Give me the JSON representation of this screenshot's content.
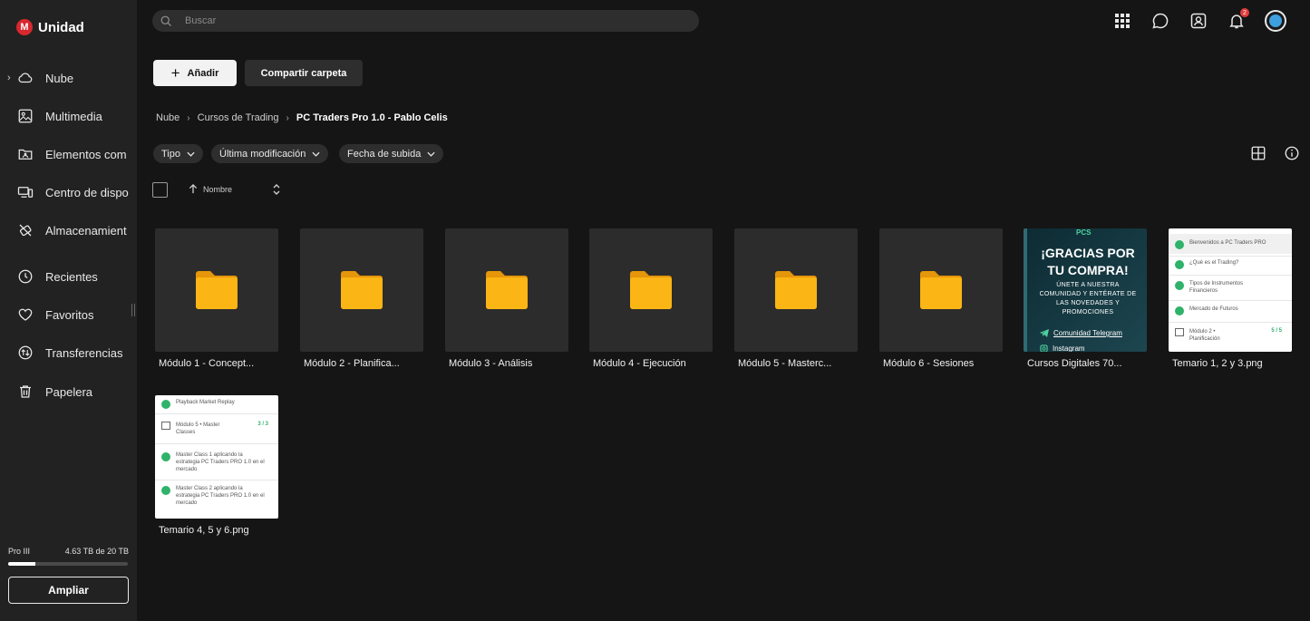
{
  "app": {
    "name": "Unidad",
    "logo_letter": "M"
  },
  "sidebar": {
    "items": [
      {
        "label": "Nube",
        "icon": "cloud-icon"
      },
      {
        "label": "Multimedia",
        "icon": "image-icon"
      },
      {
        "label": "Elementos com",
        "icon": "shared-folder-icon"
      },
      {
        "label": "Centro de dispo",
        "icon": "devices-icon"
      },
      {
        "label": "Almacenamient",
        "icon": "storage-icon"
      },
      {
        "label": "Recientes",
        "icon": "clock-icon"
      },
      {
        "label": "Favoritos",
        "icon": "heart-icon"
      },
      {
        "label": "Transferencias",
        "icon": "transfer-icon"
      },
      {
        "label": "Papelera",
        "icon": "trash-icon"
      }
    ],
    "plan": {
      "name": "Pro III",
      "usage": "4.63 TB de 20 TB",
      "used_fraction": 0.23
    },
    "upgrade_label": "Ampliar"
  },
  "topbar": {
    "search_placeholder": "Buscar",
    "notification_count": "2"
  },
  "toolbar": {
    "add_label": "Añadir",
    "share_label": "Compartir carpeta"
  },
  "breadcrumb": {
    "root": "Nube",
    "parent": "Cursos de Trading",
    "current": "PC Traders Pro 1.0 - Pablo Celis"
  },
  "filters": {
    "type": "Tipo",
    "modified": "Última modificación",
    "uploaded": "Fecha de subida"
  },
  "list_header": {
    "sort_label": "Nombre"
  },
  "items": [
    {
      "name": "Módulo 1 - Concept...",
      "kind": "folder"
    },
    {
      "name": "Módulo 2 - Planifica...",
      "kind": "folder"
    },
    {
      "name": "Módulo 3 - Análisis",
      "kind": "folder"
    },
    {
      "name": "Módulo 4 - Ejecución",
      "kind": "folder"
    },
    {
      "name": "Módulo 5 - Masterc...",
      "kind": "folder"
    },
    {
      "name": "Módulo 6 - Sesiones",
      "kind": "folder"
    },
    {
      "name": "Cursos Digitales 70...",
      "kind": "image"
    },
    {
      "name": "Temario 1, 2 y 3.png",
      "kind": "image"
    },
    {
      "name": "Temario 4, 5 y 6.png",
      "kind": "image"
    }
  ],
  "promo_thumb": {
    "top": "PCS",
    "headline_1": "¡GRACIAS POR",
    "headline_2": "TU COMPRA!",
    "body_1": "ÚNETE A NUESTRA",
    "body_2": "COMUNIDAD Y ENTÉRATE DE",
    "body_3": "LAS NOVEDADES Y",
    "body_4": "PROMOCIONES",
    "link_1": "Comunidad Telegram",
    "link_2": "Instagram"
  },
  "syllabus_1": {
    "row1": "Bienvenidos a PC Traders PRO",
    "row2": "¿Qué es el Trading?",
    "row3": "Tipos de Instrumentos Financieros",
    "row4": "Mercado de Futuros",
    "row5": "Módulo 2 • Planificación",
    "row5_count": "5 / 5"
  },
  "syllabus_2": {
    "row1": "Playback Market Replay",
    "row2": "Módulo 5 • Master Classes",
    "row2_count": "3 / 3",
    "row3": "Master Class 1 aplicando la estrategia PC Traders PRO 1.0 en el mercado",
    "row4": "Master Class 2 aplicando la estrategia PC Traders PRO 1.0 en el mercado"
  },
  "colors": {
    "background": "#151515",
    "sidebar": "#222222",
    "folder": "#f5a80c",
    "accent": "#d9272e"
  }
}
